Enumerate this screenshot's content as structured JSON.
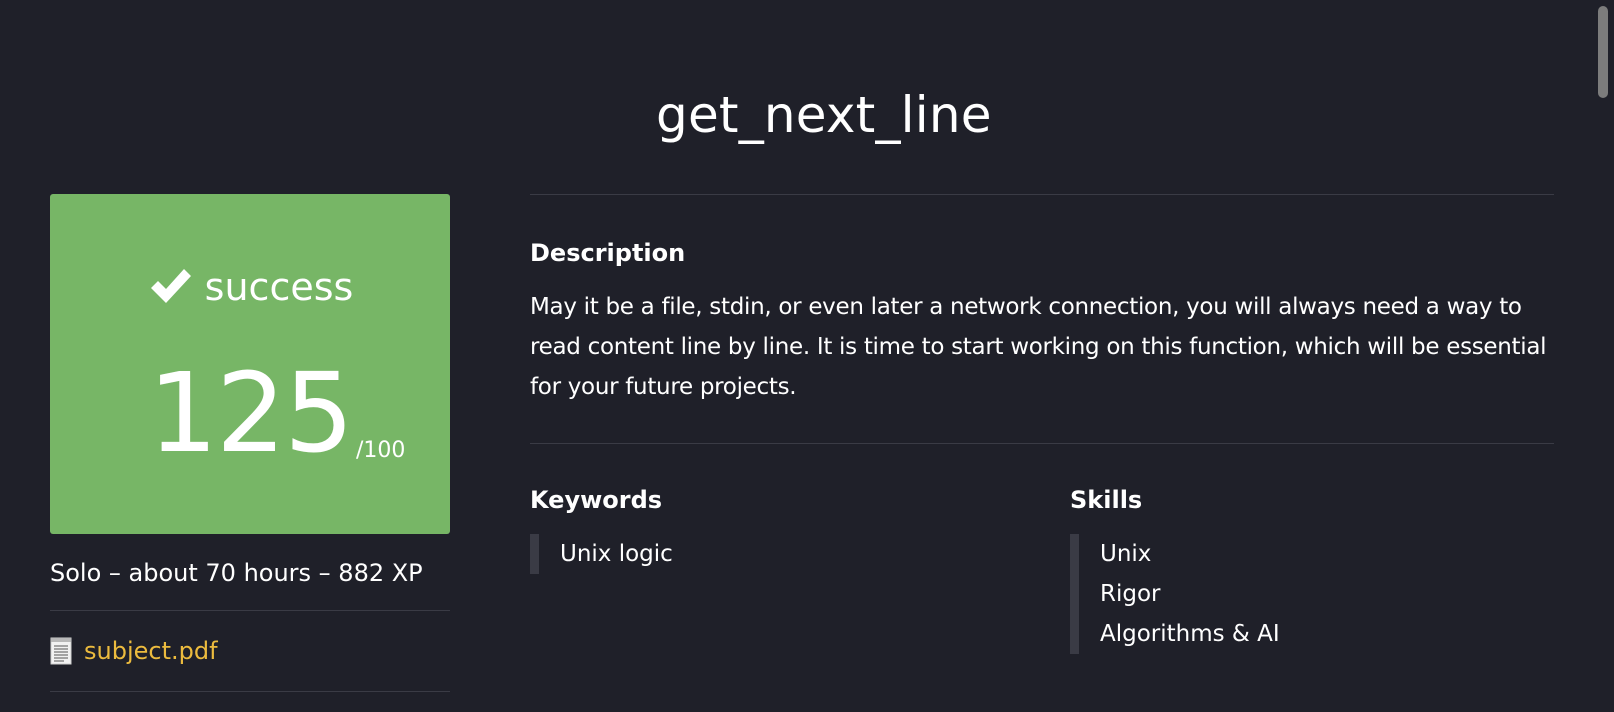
{
  "project": {
    "title": "get_next_line"
  },
  "status": {
    "icon": "check-icon",
    "label": "success",
    "score": "125",
    "max_score": "/100",
    "color": "#77b666"
  },
  "meta": {
    "text": "Solo – about 70 hours – 882 XP"
  },
  "attachment": {
    "icon": "document-icon",
    "label": "subject.pdf",
    "color": "#ecbb3e"
  },
  "description": {
    "title": "Description",
    "text": "May it be a file, stdin, or even later a network connection, you will always need a way to read content line by line. It is time to start working on this function, which will be essential for your future projects."
  },
  "keywords": {
    "title": "Keywords",
    "items": [
      "Unix logic"
    ]
  },
  "skills": {
    "title": "Skills",
    "items": [
      "Unix",
      "Rigor",
      "Algorithms & AI"
    ]
  },
  "theme": {
    "background": "#1f2029",
    "divider": "#3a3b45",
    "text": "#ffffff"
  }
}
